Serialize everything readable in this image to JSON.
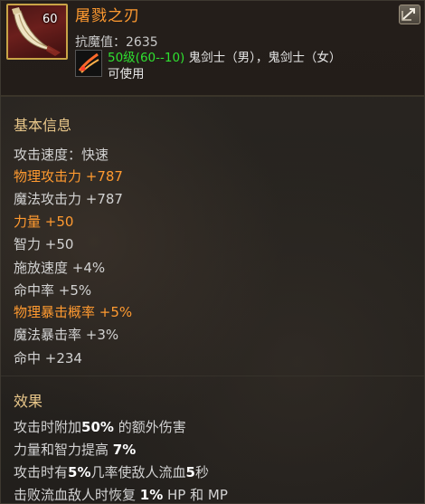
{
  "header": {
    "level": "60",
    "item_name": "屠戮之刃",
    "resist": "抗魔值：2635",
    "req_level": "50级(60--10)",
    "classes": " 鬼剑士（男），鬼剑士（女）",
    "usable": "可使用",
    "icons": {
      "item": "curved-blade-icon",
      "class": "ghost-swordsman-icon",
      "compare": "compare-icon"
    }
  },
  "basic_info": {
    "title": "基本信息",
    "stats": [
      {
        "label": "攻击速度：快速",
        "highlight": false
      },
      {
        "label": "物理攻击力 +787",
        "highlight": true
      },
      {
        "label": "魔法攻击力 +787",
        "highlight": false
      },
      {
        "label": "力量 +50",
        "highlight": true
      },
      {
        "label": "智力 +50",
        "highlight": false
      },
      {
        "label": "施放速度 +4%",
        "highlight": false
      },
      {
        "label": "命中率 +5%",
        "highlight": false
      },
      {
        "label": "物理暴击概率 +5%",
        "highlight": true
      },
      {
        "label": "魔法暴击率 +3%",
        "highlight": false
      },
      {
        "label": "命中 +234",
        "highlight": false
      }
    ]
  },
  "effects": {
    "title": "效果",
    "lines": [
      {
        "a": "攻击时附加",
        "b": "50%",
        "c": " 的额外伤害",
        "d": "",
        "e": "",
        "f": ""
      },
      {
        "a": "力量和智力提高 ",
        "b": "7%",
        "c": "",
        "d": "",
        "e": "",
        "f": ""
      },
      {
        "a": "攻击时有",
        "b": "5%",
        "c": "几率使敌人流血",
        "d": "5",
        "e": "秒",
        "f": ""
      },
      {
        "a": "击败流血敌人时恢复 ",
        "b": "1%",
        "c": " HP 和 MP",
        "d": "",
        "e": "",
        "f": ""
      }
    ]
  },
  "colors": {
    "item_name": "#ff9a30",
    "highlight": "#ff9a30",
    "req_level": "#2fe030",
    "section_title": "#e9c78a",
    "text": "#d2d2d2",
    "icon_border": "#c9a447"
  }
}
